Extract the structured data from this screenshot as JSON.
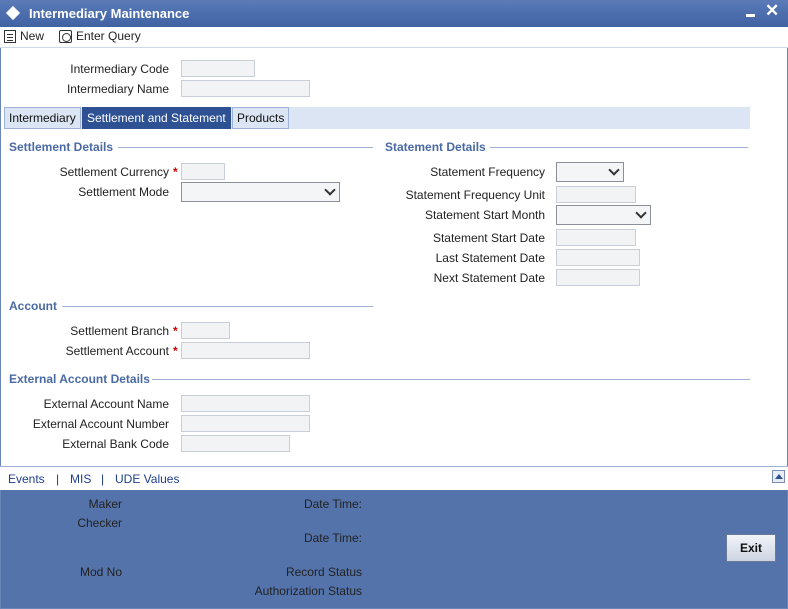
{
  "window": {
    "title": "Intermediary Maintenance",
    "minimize_icon": "minimize-icon",
    "close_icon": "close-icon"
  },
  "toolbar": {
    "new_label": "New",
    "enter_query_label": "Enter Query"
  },
  "header": {
    "code_label": "Intermediary Code",
    "name_label": "Intermediary Name",
    "code_value": "",
    "name_value": ""
  },
  "tabs": [
    "Intermediary",
    "Settlement and Statement",
    "Products"
  ],
  "settlement": {
    "title": "Settlement Details",
    "currency_label": "Settlement Currency",
    "mode_label": "Settlement Mode",
    "required_mark": "*"
  },
  "statement": {
    "title": "Statement Details",
    "frequency_label": "Statement Frequency",
    "frequency_unit_label": "Statement Frequency Unit",
    "start_month_label": "Statement Start Month",
    "start_date_label": "Statement Start Date",
    "last_date_label": "Last Statement Date",
    "next_date_label": "Next Statement Date"
  },
  "account": {
    "title": "Account",
    "branch_label": "Settlement Branch",
    "account_label": "Settlement Account"
  },
  "external": {
    "title": "External Account Details",
    "name_label": "External Account Name",
    "number_label": "External Account Number",
    "bank_code_label": "External Bank Code"
  },
  "links": {
    "events": "Events",
    "mis": "MIS",
    "ude": "UDE Values",
    "separator": "|"
  },
  "footer": {
    "maker": "Maker",
    "checker": "Checker",
    "date_time_1": "Date Time:",
    "date_time_2": "Date Time:",
    "mod_no": "Mod No",
    "record_status": "Record Status",
    "authorization_status": "Authorization Status",
    "exit_label": "Exit"
  },
  "colors": {
    "title_bar": "#3f62a3",
    "active_tab": "#2e5194",
    "footer": "#5473aa",
    "section_title": "#4a6aa3"
  }
}
